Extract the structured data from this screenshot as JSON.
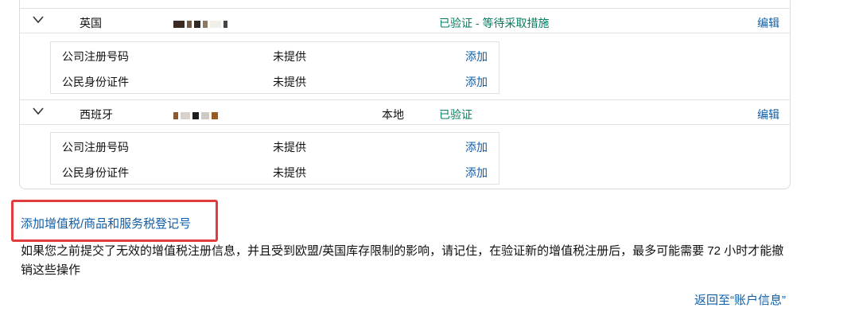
{
  "countries": [
    {
      "name": "英国",
      "local": "",
      "status": "已验证 - 等待采取措施",
      "edit": "编辑",
      "fields": [
        {
          "label": "公司注册号码",
          "value": "未提供",
          "action": "添加"
        },
        {
          "label": "公民身份证件",
          "value": "未提供",
          "action": "添加"
        }
      ]
    },
    {
      "name": "西班牙",
      "local": "本地",
      "status": "已验证",
      "edit": "编辑",
      "fields": [
        {
          "label": "公司注册号码",
          "value": "未提供",
          "action": "添加"
        },
        {
          "label": "公民身份证件",
          "value": "未提供",
          "action": "添加"
        }
      ]
    }
  ],
  "add_vat_link": "添加增值税/商品和服务税登记号",
  "notice": "如果您之前提交了无效的增值税注册信息，并且受到欧盟/英国库存限制的影响，请记住，在验证新的增值税注册后，最多可能需要 72 小时才能撤销这些操作",
  "back_link": "返回至“账户信息”",
  "colors": {
    "link": "#0f5ea8",
    "verified": "#067d62",
    "highlight": "#e23b3b"
  }
}
